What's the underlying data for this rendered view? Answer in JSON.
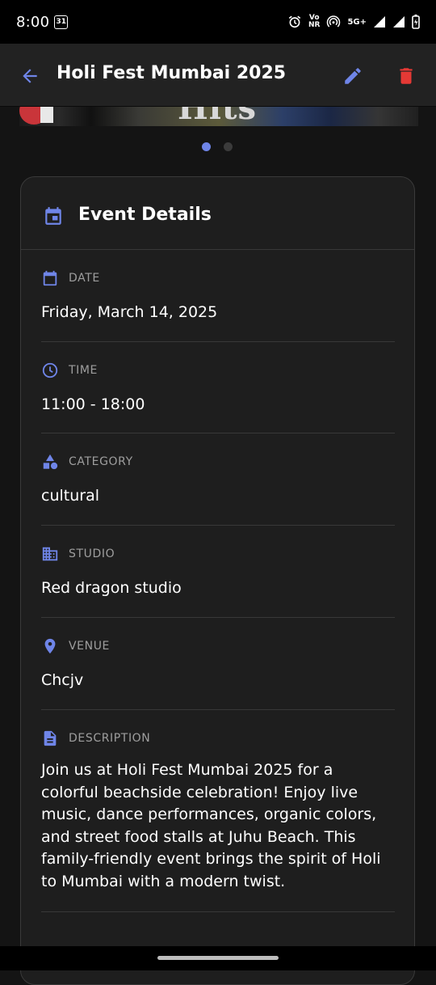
{
  "status_bar": {
    "time": "8:00",
    "calendar_day": "31",
    "volte_top": "Vo",
    "volte_bottom": "NR",
    "network": "5G+"
  },
  "app_bar": {
    "title": "Holi Fest Mumbai 2025",
    "back_icon": "arrow-back-icon",
    "edit_icon": "pencil-icon",
    "delete_icon": "trash-icon"
  },
  "carousel": {
    "banner_text": "Hits",
    "page_count": 2,
    "active_index": 0
  },
  "card": {
    "title": "Event Details",
    "sections": [
      {
        "label": "DATE",
        "value": "Friday, March 14, 2025",
        "icon": "calendar-icon"
      },
      {
        "label": "TIME",
        "value": "11:00 - 18:00",
        "icon": "clock-icon"
      },
      {
        "label": "CATEGORY",
        "value": "cultural",
        "icon": "shapes-icon"
      },
      {
        "label": "STUDIO",
        "value": "Red dragon studio",
        "icon": "building-icon"
      },
      {
        "label": "VENUE",
        "value": "Chcjv",
        "icon": "location-pin-icon"
      },
      {
        "label": "DESCRIPTION",
        "value": "Join us at Holi Fest Mumbai 2025 for a colorful beachside celebration! Enjoy live music, dance performances, organic colors, and street food stalls at Juhu Beach. This family-friendly event brings the spirit of Holi to Mumbai with a modern twist.",
        "icon": "document-icon"
      }
    ]
  },
  "colors": {
    "accent": "#6f85e8",
    "delete": "#e53935",
    "background": "#141414",
    "card": "#1e1e1e"
  }
}
